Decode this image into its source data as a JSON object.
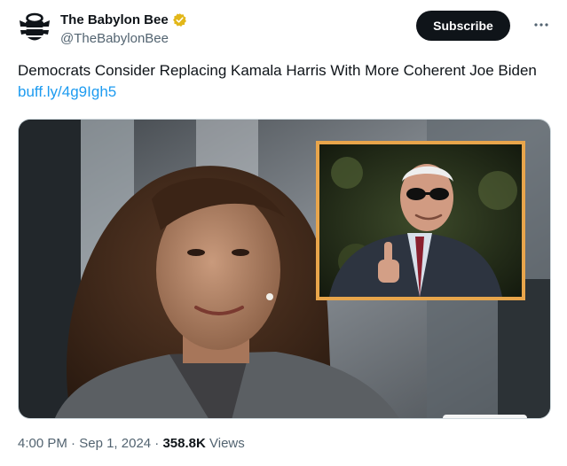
{
  "account": {
    "display_name": "The Babylon Bee",
    "handle": "@TheBabylonBee",
    "verified_badge_color": "#e2b719",
    "avatar_icon": "bee-logo-icon"
  },
  "actions": {
    "subscribe_label": "Subscribe",
    "more_icon": "more-options-icon"
  },
  "tweet": {
    "text": "Democrats Consider Replacing Kamala Harris With More Coherent Joe Biden",
    "link_text": "buff.ly/4g9Igh5",
    "link_color": "#1d9bf0"
  },
  "media": {
    "description_icon": "photo-composite",
    "inset_border_color": "#e8a54b"
  },
  "meta": {
    "time": "4:00 PM",
    "separator": "·",
    "date": "Sep 1, 2024",
    "views_count": "358.8K",
    "views_label": "Views"
  }
}
